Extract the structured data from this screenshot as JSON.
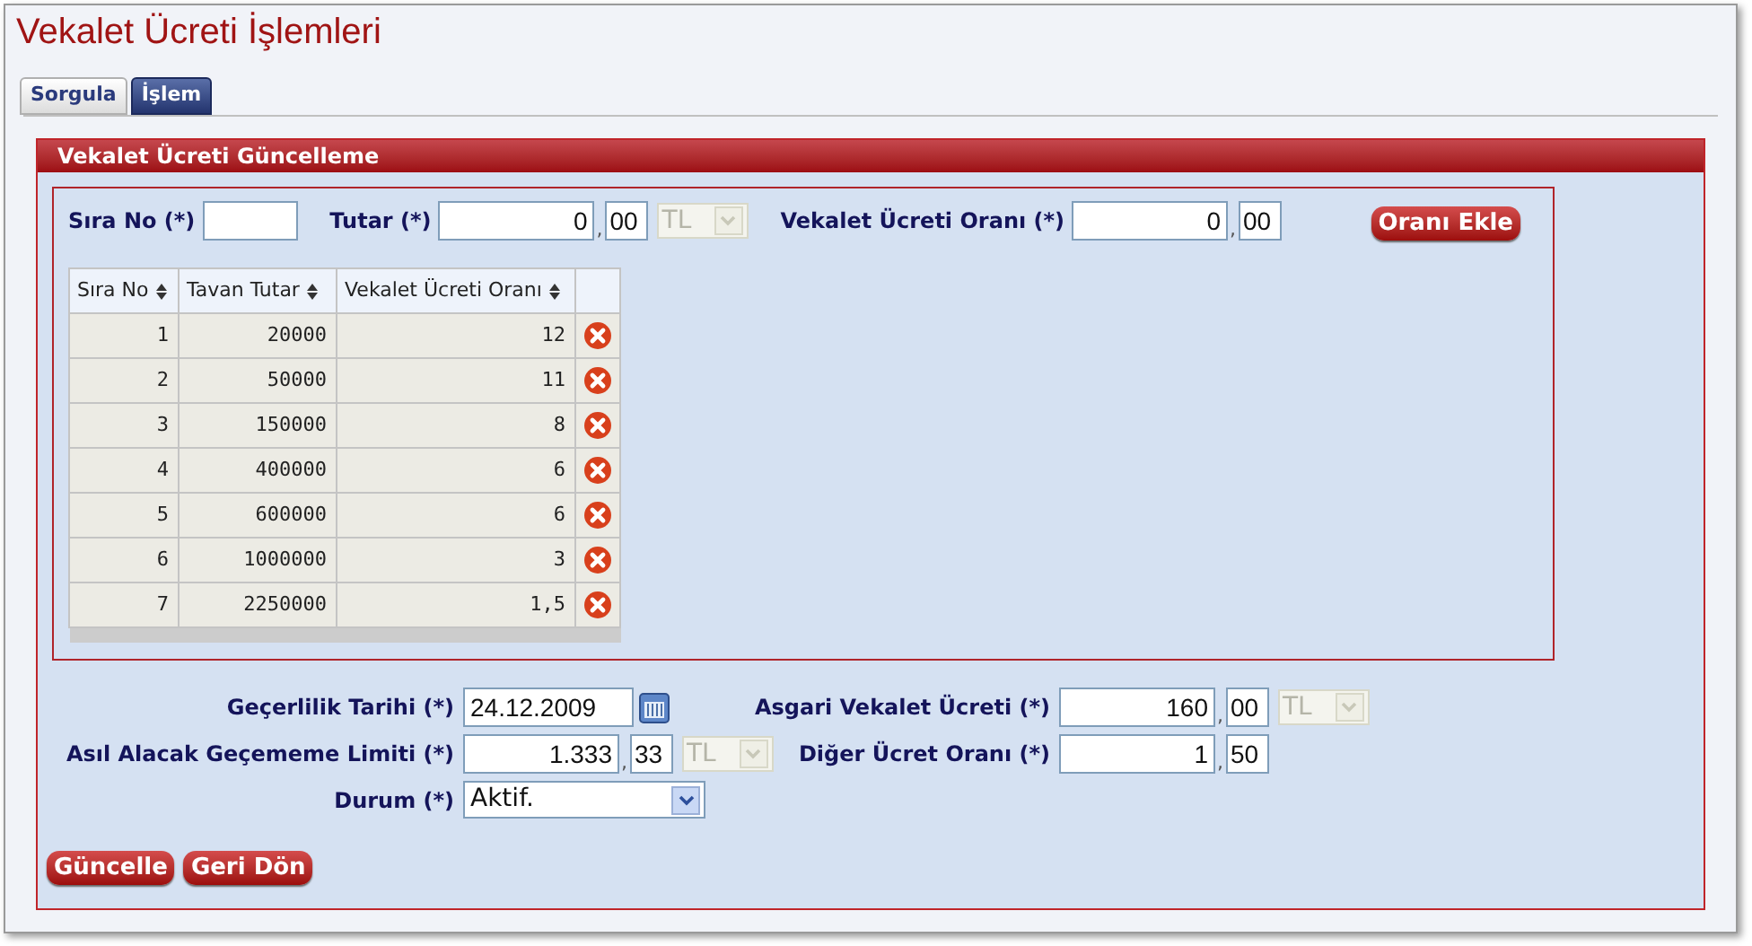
{
  "page_title": "Vekalet Ücreti İşlemleri",
  "tabs": [
    {
      "label": "Sorgula",
      "selected": false
    },
    {
      "label": "İşlem",
      "selected": true
    }
  ],
  "section_title": "Vekalet Ücreti Güncelleme",
  "entry_fields": [
    {
      "kind": "text",
      "label": "Sıra No (*)"
    },
    {
      "kind": "amount",
      "label": "Tutar (*)",
      "value": "0",
      "separator": ",",
      "decimals": "00",
      "currency": "TL",
      "currency_disabled": true
    },
    {
      "kind": "amount",
      "label": "Vekalet Ücreti Oranı (*)",
      "value": "0",
      "separator": ",",
      "decimals": "00"
    }
  ],
  "add_button": "Oranı Ekle",
  "table": {
    "columns": [
      "Sıra No",
      "Tavan Tutar",
      "Vekalet Ücreti Oranı"
    ],
    "rows": [
      [
        "1",
        "20000",
        "12"
      ],
      [
        "2",
        "50000",
        "11"
      ],
      [
        "3",
        "150000",
        "8"
      ],
      [
        "4",
        "400000",
        "6"
      ],
      [
        "5",
        "600000",
        "6"
      ],
      [
        "6",
        "1000000",
        "3"
      ],
      [
        "7",
        "2250000",
        "1,5"
      ]
    ]
  },
  "left_fields": [
    {
      "kind": "date",
      "label": "Geçerlilik Tarihi (*)",
      "value": "24.12.2009"
    },
    {
      "kind": "amount",
      "label": "Asıl Alacak Geçememe Limiti (*)",
      "value": "1.333",
      "separator": ",",
      "decimals": "33",
      "currency": "TL",
      "currency_disabled": true
    },
    {
      "kind": "select",
      "label": "Durum (*)",
      "value": "Aktif."
    }
  ],
  "right_fields": [
    {
      "kind": "amount",
      "label": "Asgari Vekalet Ücreti (*)",
      "value": "160",
      "separator": ",",
      "decimals": "00",
      "currency": "TL",
      "currency_disabled": true
    },
    {
      "kind": "amount",
      "label": "Diğer Ücret Oranı (*)",
      "value": "1",
      "separator": ",",
      "decimals": "50"
    }
  ],
  "buttons": [
    "Güncelle",
    "Geri Dön"
  ]
}
